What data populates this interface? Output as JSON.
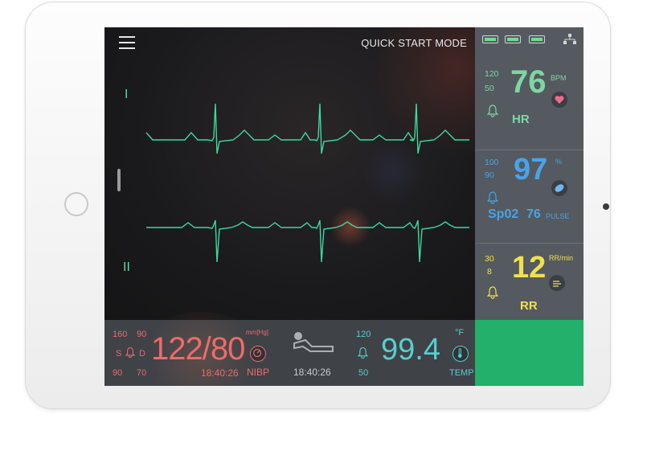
{
  "header": {
    "menu_icon": "hamburger-menu-icon",
    "mode_title": "QUICK START MODE"
  },
  "status_icons": [
    "battery-icon",
    "battery-icon",
    "battery-icon",
    "network-icon"
  ],
  "leads": {
    "lead_1": "I",
    "lead_2": "II"
  },
  "hr": {
    "high": "120",
    "low": "50",
    "value": "76",
    "unit": "BPM",
    "name": "HR",
    "color": "#7ed6a4",
    "icon": "heart-icon"
  },
  "spo2": {
    "high": "100",
    "low": "90",
    "value": "97",
    "unit": "%",
    "name": "Sp02",
    "pulse_value": "76",
    "pulse_label": "PULSE",
    "color": "#4aa3e6",
    "icon": "blood-drop-icon"
  },
  "rr": {
    "high": "30",
    "low": "8",
    "value": "12",
    "unit": "RR/min",
    "name": "RR",
    "color": "#f0e050",
    "icon": "lungs-icon"
  },
  "nibp": {
    "sys_high": "160",
    "dia_high": "90",
    "label_s": "S",
    "label_d": "D",
    "sys_low": "90",
    "dia_low": "70",
    "value": "122/80",
    "unit": "mm[Hg]",
    "time": "18:40:26",
    "name": "NIBP",
    "color": "#ee6b6b",
    "icon": "gauge-icon"
  },
  "patient": {
    "icon": "patient-bed-icon",
    "time": "18:40:26"
  },
  "temp": {
    "high": "120",
    "low": "50",
    "value": "99.4",
    "unit": "°F",
    "name": "TEMP",
    "color": "#55d0cf",
    "icon": "thermometer-icon"
  }
}
